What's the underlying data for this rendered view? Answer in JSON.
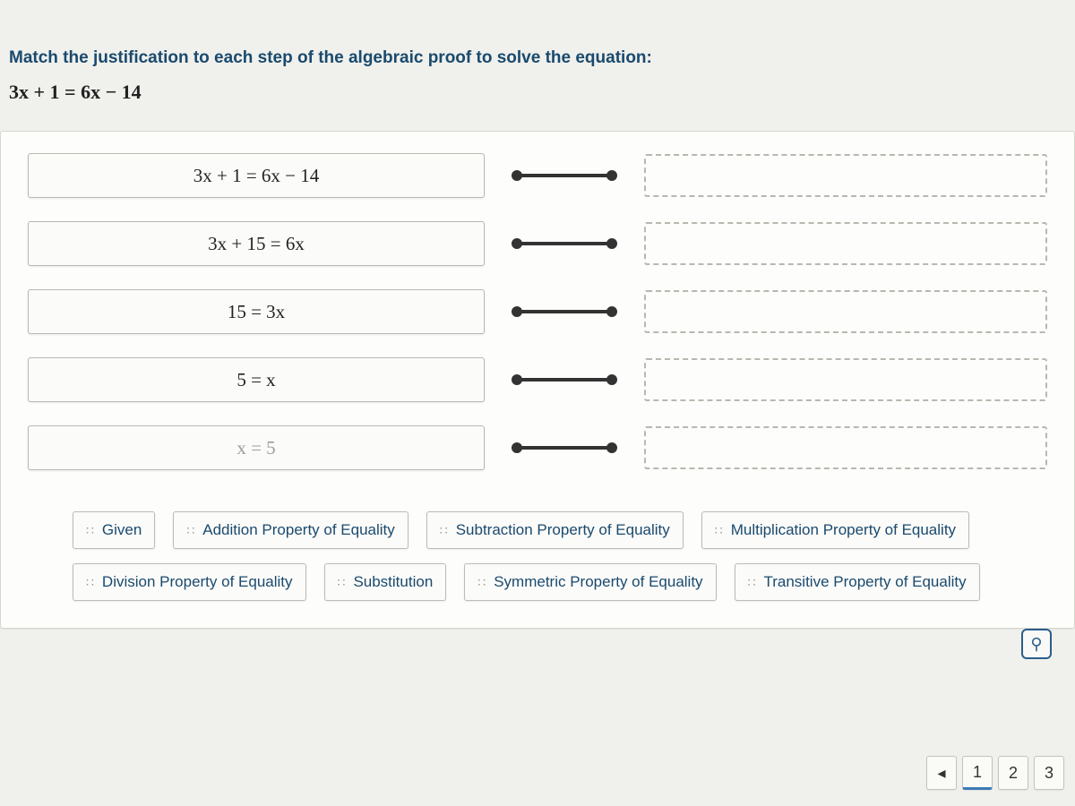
{
  "prompt": "Match the justification to each step of the algebraic proof to solve the equation:",
  "given_equation": "3x + 1 = 6x − 14",
  "steps": [
    {
      "expr": "3x + 1 = 6x − 14",
      "faded": false
    },
    {
      "expr": "3x + 15 = 6x",
      "faded": false
    },
    {
      "expr": "15 = 3x",
      "faded": false
    },
    {
      "expr": "5 = x",
      "faded": false
    },
    {
      "expr": "x = 5",
      "faded": true
    }
  ],
  "choices": [
    "Given",
    "Addition Property of Equality",
    "Subtraction Property of Equality",
    "Multiplication Property of Equality",
    "Division Property of Equality",
    "Substitution",
    "Symmetric Property of Equality",
    "Transitive Property of Equality"
  ],
  "pager": {
    "prev": "◂",
    "pages": [
      "1",
      "2",
      "3"
    ],
    "active": "1"
  },
  "accessibility_icon": "⚲"
}
